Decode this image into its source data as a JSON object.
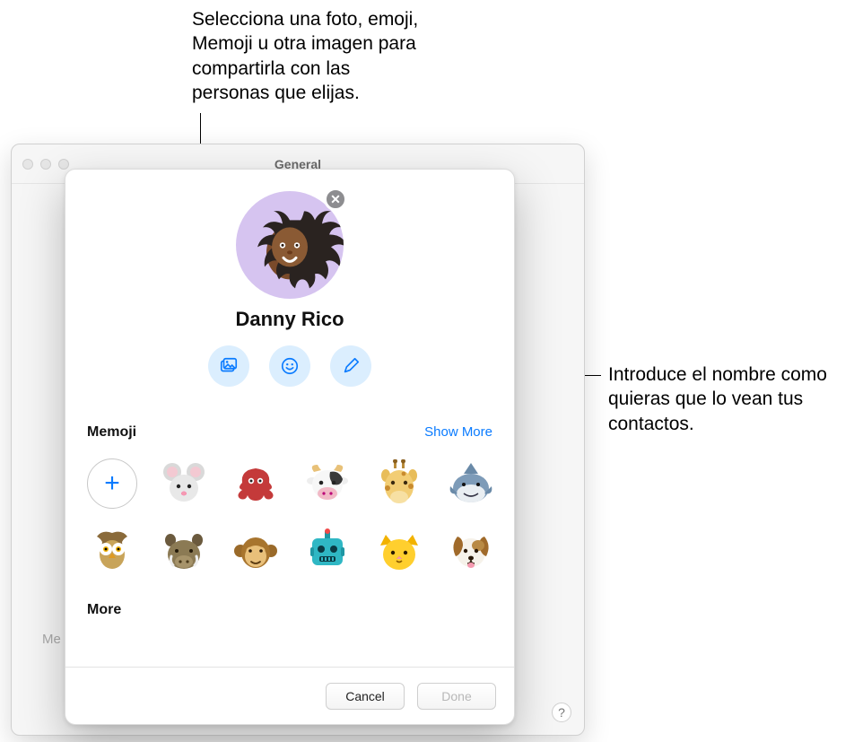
{
  "callouts": {
    "top": "Selecciona una foto, emoji, Memoji u otra imagen para compartirla con las personas que elijas.",
    "right": "Introduce el nombre como quieras que lo vean tus contactos."
  },
  "window": {
    "title": "General",
    "dim_label": "Me",
    "help_tooltip": "?"
  },
  "sheet": {
    "name": "Danny Rico",
    "clear_label": "✕",
    "actions": {
      "photos": "photos-icon",
      "emoji": "emoji-icon",
      "edit": "edit-icon"
    },
    "memoji": {
      "title": "Memoji",
      "show_more": "Show More",
      "add_label": "+",
      "items": [
        {
          "name": "mouse"
        },
        {
          "name": "octopus"
        },
        {
          "name": "cow"
        },
        {
          "name": "giraffe"
        },
        {
          "name": "shark"
        },
        {
          "name": "owl"
        },
        {
          "name": "boar"
        },
        {
          "name": "monkey"
        },
        {
          "name": "robot"
        },
        {
          "name": "cat"
        },
        {
          "name": "dog"
        }
      ]
    },
    "more": {
      "title": "More"
    },
    "footer": {
      "cancel": "Cancel",
      "done": "Done"
    }
  }
}
